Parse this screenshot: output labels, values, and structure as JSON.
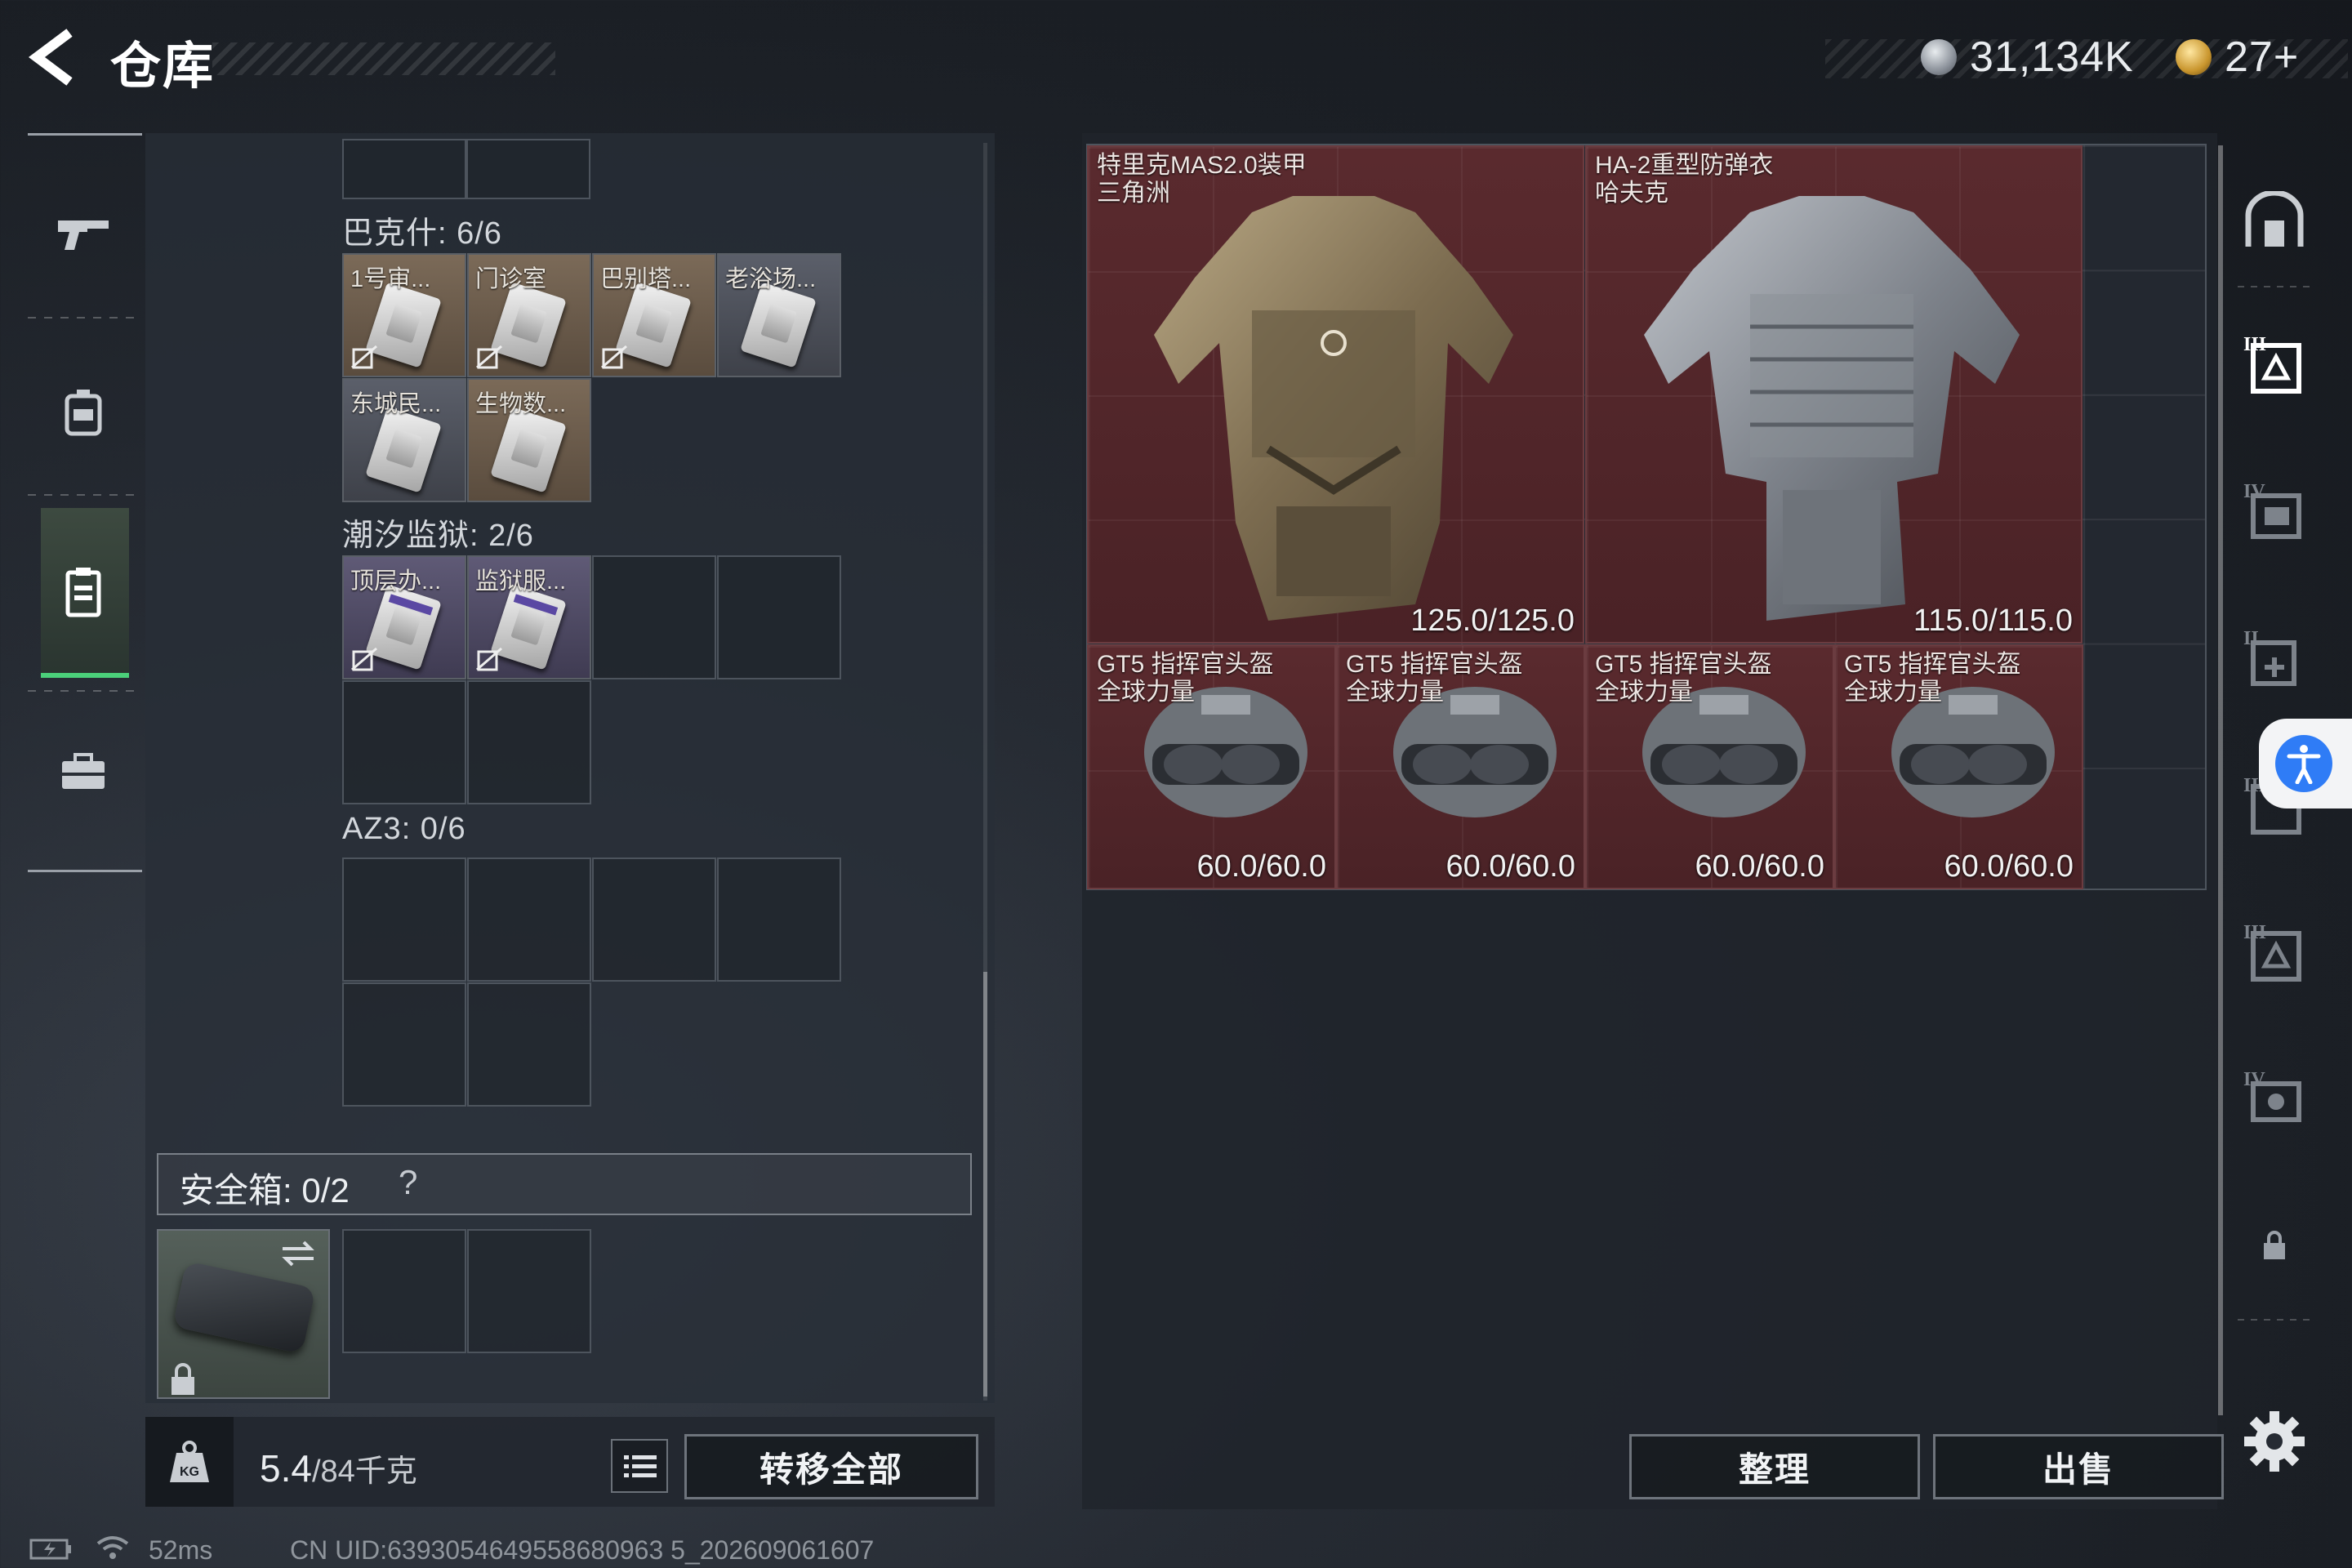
{
  "header": {
    "title": "仓库",
    "currency_silver": "31,134K",
    "currency_gold": "27+"
  },
  "bag": {
    "sections": [
      {
        "label": "巴克什: 6/6",
        "items": [
          "1号审...",
          "门诊室",
          "巴别塔...",
          "老浴场...",
          "东城民...",
          "生物数..."
        ]
      },
      {
        "label": "潮汐监狱: 2/6",
        "items": [
          "顶层办...",
          "监狱服..."
        ]
      },
      {
        "label": "AZ3: 0/6",
        "items": []
      }
    ],
    "safebox_label": "安全箱: 0/2",
    "safebox_help": "?",
    "weight_value": "5.4",
    "weight_max": "/84千克",
    "transfer_all": "转移全部"
  },
  "stash": {
    "armor": [
      {
        "name": "特里克MAS2.0装甲",
        "subtitle": "三角洲",
        "durability": "125.0/125.0"
      },
      {
        "name": "HA-2重型防弹衣",
        "subtitle": "哈夫克",
        "durability": "115.0/115.0"
      }
    ],
    "helmets": [
      {
        "name": "GT5 指挥官头盔",
        "subtitle": "全球力量",
        "durability": "60.0/60.0"
      },
      {
        "name": "GT5 指挥官头盔",
        "subtitle": "全球力量",
        "durability": "60.0/60.0"
      },
      {
        "name": "GT5 指挥官头盔",
        "subtitle": "全球力量",
        "durability": "60.0/60.0"
      },
      {
        "name": "GT5 指挥官头盔",
        "subtitle": "全球力量",
        "durability": "60.0/60.0"
      }
    ],
    "sort_label": "整理",
    "sell_label": "出售"
  },
  "status_bar": {
    "ping": "52ms",
    "uid": "CN UID:6393054649558680963 5_202609061607"
  },
  "colors": {
    "accent_green": "#4bd07a",
    "item_red": "#5a2a2e",
    "accessibility_blue": "#2f7cf6"
  }
}
